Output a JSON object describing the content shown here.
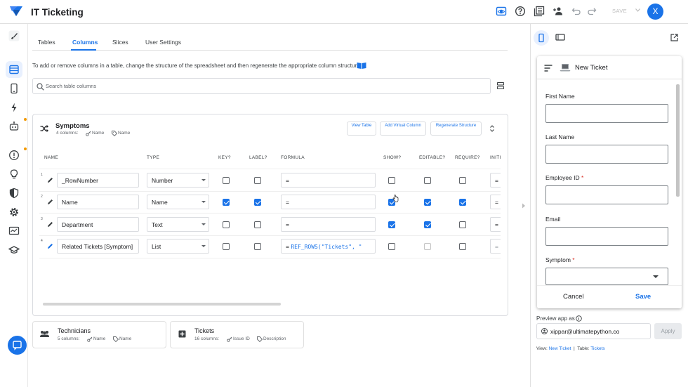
{
  "app": {
    "title": "IT Ticketing",
    "save_label": "SAVE",
    "avatar_letter": "X"
  },
  "toolbar_icons": [
    "preview-icon",
    "help-icon",
    "app-gallery-icon",
    "share-icon",
    "undo-icon",
    "redo-icon"
  ],
  "rail_icons": [
    "brush-icon",
    "data-icon",
    "app-icon",
    "automation-icon",
    "bot-icon",
    "alert-icon",
    "lightbulb-icon",
    "security-icon",
    "settings-icon",
    "monitor-icon",
    "school-icon"
  ],
  "tabs": [
    {
      "label": "Tables"
    },
    {
      "label": "Columns"
    },
    {
      "label": "Slices"
    },
    {
      "label": "User Settings"
    }
  ],
  "hint": "To add or remove columns in a table, change the structure of the spreadsheet and then regenerate the appropriate column structure",
  "search": {
    "placeholder": "Search table columns"
  },
  "table_card": {
    "title": "Symptoms",
    "columns_count": "4 columns:",
    "key_label": "Name",
    "label_label": "Name",
    "btn_view": "View Table",
    "btn_virtual": "Add Virtual Column",
    "btn_regen": "Regenerate Structure"
  },
  "headers": {
    "name": "NAME",
    "type": "TYPE",
    "key": "KEY?",
    "label": "LABEL?",
    "formula": "FORMULA",
    "show": "SHOW?",
    "editable": "EDITABLE?",
    "require": "REQUIRE?",
    "init": "INITI"
  },
  "rows": [
    {
      "num": "1",
      "name": "_RowNumber",
      "type": "Number",
      "formula_prefix": "=",
      "formula_code": "",
      "init": "=",
      "key": false,
      "label": false,
      "show": false,
      "editable": false,
      "require": false
    },
    {
      "num": "2",
      "name": "Name",
      "type": "Name",
      "formula_prefix": "=",
      "formula_code": "",
      "init": "=",
      "key": true,
      "label": true,
      "show": true,
      "editable": true,
      "require": true
    },
    {
      "num": "3",
      "name": "Department",
      "type": "Text",
      "formula_prefix": "=",
      "formula_code": "",
      "init": "=",
      "key": false,
      "label": false,
      "show": true,
      "editable": true,
      "require": false
    },
    {
      "num": "4",
      "name": "Related Tickets [Symptom]",
      "type": "List",
      "formula_prefix": "=",
      "formula_code": "REF_ROWS(\"Tickets\", \"",
      "init": "=",
      "key": false,
      "label": false,
      "show": false,
      "editable": false,
      "require": false
    }
  ],
  "other_tables": [
    {
      "name": "Technicians",
      "columns": "5 columns:",
      "key": "Name",
      "label": "Name"
    },
    {
      "name": "Tickets",
      "columns": "16 columns:",
      "key": "Issue ID",
      "label": "Description"
    }
  ],
  "preview": {
    "view_title": "New Ticket",
    "fields": [
      {
        "label": "First Name",
        "required": ""
      },
      {
        "label": "Last Name",
        "required": ""
      },
      {
        "label": "Employee ID",
        "required": "*"
      },
      {
        "label": "Email",
        "required": ""
      },
      {
        "label": "Symptom",
        "required": "*"
      }
    ],
    "cancel": "Cancel",
    "save": "Save",
    "preview_as_label": "Preview app as",
    "email": "xippar@ultimatepython.co",
    "apply": "Apply",
    "view_prefix": "View:",
    "view_name": "New Ticket",
    "sep": "|",
    "table_prefix": "Table:",
    "table_name": "Tickets"
  },
  "colors": {
    "accent": "#1a73e8",
    "required": "#d93025",
    "notify_dot": "#f29900"
  }
}
